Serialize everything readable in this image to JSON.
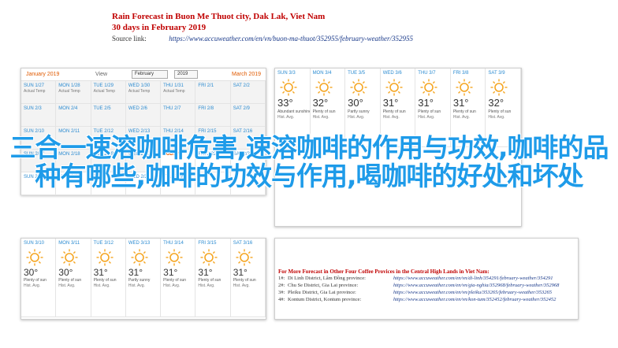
{
  "header": {
    "title1": "Rain Forecast in Buon Me Thuot city, Dak Lak, Viet Nam",
    "title2": "30 days in February 2019",
    "source_label": "Source link:",
    "source_url": "https://www.accuweather.com/en/vn/buon-ma-thuot/352955/february-weather/352955"
  },
  "feb_toolbar": {
    "prev": "January 2019",
    "view_label": "View",
    "month": "February",
    "year": "2019",
    "next": "March 2019"
  },
  "feb_rows": [
    [
      {
        "day": "SUN 1/27",
        "sub": "Actual Temp",
        "temp": "",
        "cond": "",
        "hist": "",
        "grey": true
      },
      {
        "day": "MON 1/28",
        "sub": "Actual Temp",
        "temp": "",
        "cond": "",
        "hist": "",
        "grey": true
      },
      {
        "day": "TUE 1/29",
        "sub": "Actual Temp",
        "temp": "",
        "cond": "",
        "hist": "",
        "grey": true
      },
      {
        "day": "WED 1/30",
        "sub": "Actual Temp",
        "temp": "",
        "cond": "",
        "hist": "",
        "grey": true
      },
      {
        "day": "THU 1/31",
        "sub": "Actual Temp",
        "temp": "",
        "cond": "",
        "hist": "",
        "grey": true
      },
      {
        "day": "FRI 2/1",
        "sub": "",
        "temp": "",
        "cond": "",
        "hist": "",
        "grey": true
      },
      {
        "day": "SAT 2/2",
        "sub": "",
        "temp": "",
        "cond": "",
        "hist": "",
        "grey": true
      }
    ],
    [
      {
        "day": "SUN 2/3",
        "sub": "",
        "temp": "",
        "cond": "",
        "hist": "",
        "grey": true
      },
      {
        "day": "MON 2/4",
        "sub": "",
        "temp": "",
        "cond": "",
        "hist": "",
        "grey": true
      },
      {
        "day": "TUE 2/5",
        "sub": "",
        "temp": "",
        "cond": "",
        "hist": "",
        "grey": true
      },
      {
        "day": "WED 2/6",
        "sub": "",
        "temp": "",
        "cond": "",
        "hist": "",
        "grey": true
      },
      {
        "day": "THU 2/7",
        "sub": "",
        "temp": "",
        "cond": "",
        "hist": "",
        "grey": true
      },
      {
        "day": "FRI 2/8",
        "sub": "",
        "temp": "",
        "cond": "",
        "hist": "",
        "grey": true
      },
      {
        "day": "SAT 2/9",
        "sub": "",
        "temp": "",
        "cond": "",
        "hist": "",
        "grey": true
      }
    ],
    [
      {
        "day": "SUN 2/10",
        "sub": "",
        "temp": "",
        "cond": "",
        "hist": "",
        "grey": true
      },
      {
        "day": "MON 2/11",
        "sub": "",
        "temp": "",
        "cond": "",
        "hist": "",
        "grey": true
      },
      {
        "day": "TUE 2/12",
        "sub": "",
        "temp": "",
        "cond": "",
        "hist": "",
        "grey": true
      },
      {
        "day": "WED 2/13",
        "sub": "",
        "temp": "",
        "cond": "",
        "hist": "",
        "grey": true
      },
      {
        "day": "THU 2/14",
        "sub": "",
        "temp": "",
        "cond": "",
        "hist": "",
        "grey": true
      },
      {
        "day": "FRI 2/15",
        "sub": "",
        "temp": "",
        "cond": "",
        "hist": "",
        "grey": true
      },
      {
        "day": "SAT 2/16",
        "sub": "",
        "temp": "",
        "cond": "",
        "hist": "",
        "grey": true
      }
    ],
    [
      {
        "day": "SUN 2/17",
        "sub": "",
        "temp": "",
        "cond": "",
        "hist": "",
        "grey": true
      },
      {
        "day": "MON 2/18",
        "sub": "",
        "temp": "",
        "cond": "",
        "hist": "",
        "grey": true
      },
      {
        "day": "TUE 2/19",
        "sub": "",
        "temp": "",
        "cond": "",
        "hist": "",
        "grey": true
      },
      {
        "day": "WED 2/20",
        "sub": "",
        "temp": "",
        "cond": "",
        "hist": "",
        "grey": true
      },
      {
        "day": "TODAY",
        "sub": "",
        "temp": "",
        "cond": "",
        "hist": "",
        "grey": false,
        "today": true
      },
      {
        "day": "FRI 2/22",
        "sub": "",
        "temp": "",
        "cond": "",
        "hist": "",
        "grey": false
      },
      {
        "day": "SAT 2/23",
        "sub": "",
        "temp": "",
        "cond": "",
        "hist": "",
        "grey": false
      }
    ],
    [
      {
        "day": "SUN 2/24",
        "sub": "",
        "temp": "",
        "cond": "",
        "hist": "",
        "grey": false
      },
      {
        "day": "MON 2/25",
        "sub": "",
        "temp": "",
        "cond": "",
        "hist": "",
        "grey": false
      },
      {
        "day": "TUE 2/26",
        "sub": "",
        "temp": "",
        "cond": "",
        "hist": "",
        "grey": false
      },
      {
        "day": "WED 2/27",
        "sub": "",
        "temp": "",
        "cond": "",
        "hist": "",
        "grey": false
      },
      {
        "day": "THU 2/28",
        "sub": "",
        "temp": "",
        "cond": "",
        "hist": "",
        "grey": false
      },
      {
        "day": "",
        "sub": "",
        "temp": "",
        "cond": "",
        "hist": "",
        "grey": false
      },
      {
        "day": "",
        "sub": "",
        "temp": "",
        "cond": "",
        "hist": "",
        "grey": false
      }
    ]
  ],
  "mar_cells": [
    {
      "day": "SUN 3/3",
      "temp": "33°",
      "cond": "Abundant sunshine",
      "hist": "Hist. Avg."
    },
    {
      "day": "MON 3/4",
      "temp": "32°",
      "cond": "Plenty of sun",
      "hist": "Hist. Avg."
    },
    {
      "day": "TUE 3/5",
      "temp": "30°",
      "cond": "Partly sunny",
      "hist": "Hist. Avg."
    },
    {
      "day": "WED 3/6",
      "temp": "31°",
      "cond": "Plenty of sun",
      "hist": "Hist. Avg."
    },
    {
      "day": "THU 3/7",
      "temp": "31°",
      "cond": "Plenty of sun",
      "hist": "Hist. Avg."
    },
    {
      "day": "FRI 3/8",
      "temp": "31°",
      "cond": "Plenty of sun",
      "hist": "Hist. Avg."
    },
    {
      "day": "SAT 3/9",
      "temp": "32°",
      "cond": "Plenty of sun",
      "hist": "Hist. Avg."
    }
  ],
  "bottom_cells": [
    {
      "day": "SUN 3/10",
      "temp": "30°",
      "cond": "Plenty of sun",
      "hist": "Hist. Avg."
    },
    {
      "day": "MON 3/11",
      "temp": "30°",
      "cond": "Plenty of sun",
      "hist": "Hist. Avg."
    },
    {
      "day": "TUE 3/12",
      "temp": "31°",
      "cond": "Plenty of sun",
      "hist": "Hist. Avg."
    },
    {
      "day": "WED 3/13",
      "temp": "31°",
      "cond": "Partly sunny",
      "hist": "Hist. Avg."
    },
    {
      "day": "THU 3/14",
      "temp": "31°",
      "cond": "Plenty of sun",
      "hist": "Hist. Avg."
    },
    {
      "day": "FRI 3/15",
      "temp": "31°",
      "cond": "Plenty of sun",
      "hist": "Hist. Avg."
    },
    {
      "day": "SAT 3/16",
      "temp": "31°",
      "cond": "Plenty of sun",
      "hist": "Hist. Avg."
    }
  ],
  "more": {
    "title": "For More Forecast in Other Four Coffee Provices in the Central High Lands in Viet Nam:",
    "rows": [
      {
        "num": "1#:",
        "name": "Di Linh District, Lâm Đồng province:",
        "url": "https://www.accuweather.com/en/vn/di-linh/354291/february-weather/354291"
      },
      {
        "num": "2#:",
        "name": "Chu Se District, Gia Lai province:",
        "url": "https://www.accuweather.com/en/vn/gia-nghia/352968/february-weather/352968"
      },
      {
        "num": "3#:",
        "name": "Pleiku District, Gia Lai province:",
        "url": "https://www.accuweather.com/en/vn/pleiku/353265/february-weather/353265"
      },
      {
        "num": "4#:",
        "name": "Kontum District, Kontum province:",
        "url": "https://www.accuweather.com/en/vn/kon-tum/352452/february-weather/352452"
      }
    ]
  },
  "overlay_text": "三合一速溶咖啡危害,速溶咖啡的作用与功效,咖啡的品种有哪些,咖啡的功效与作用,喝咖啡的好处和坏处",
  "colors": {
    "accent": "#1e9be9",
    "title_red": "#c00000",
    "day_blue": "#2b8bd1",
    "sun_orange": "#f5a623"
  }
}
